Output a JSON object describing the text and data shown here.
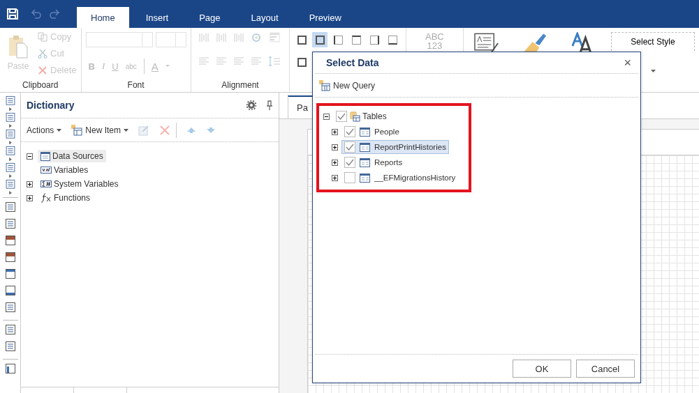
{
  "menu_bar": {
    "tabs": [
      {
        "label": "Home",
        "selected": true
      },
      {
        "label": "Insert",
        "selected": false
      },
      {
        "label": "Page",
        "selected": false
      },
      {
        "label": "Layout",
        "selected": false
      },
      {
        "label": "Preview",
        "selected": false
      }
    ]
  },
  "ribbon": {
    "clipboard": {
      "label": "Clipboard",
      "paste": {
        "label": "Paste",
        "disabled": true
      },
      "items": [
        {
          "label": "Copy",
          "disabled": true
        },
        {
          "label": "Cut",
          "disabled": true
        },
        {
          "label": "Delete",
          "disabled": true
        }
      ]
    },
    "font": {
      "label": "Font",
      "format_buttons": [
        "B",
        "I",
        "U",
        "abc"
      ],
      "color_button": "A"
    },
    "alignment": {
      "label": "Alignment"
    },
    "borders": {
      "row_1": [
        {
          "selected": false
        },
        {
          "selected": true
        },
        {
          "selected": false
        },
        {
          "selected": false
        },
        {
          "selected": false
        },
        {
          "selected": false
        }
      ],
      "row_2": [
        {
          "selected": false
        }
      ]
    },
    "sample_text": [
      "ABC",
      "123"
    ],
    "style_button": "Select Style"
  },
  "dictionary": {
    "title": "Dictionary",
    "actions": "Actions",
    "new_item": "New Item",
    "tree": [
      {
        "label": "Data Sources",
        "kind": "datasource",
        "expanded": true,
        "selected": true
      },
      {
        "label": "Variables",
        "kind": "variable",
        "selected": false
      },
      {
        "label": "System Variables",
        "kind": "sysvar",
        "expanded": false,
        "selected": false
      },
      {
        "label": "Functions",
        "kind": "function",
        "expanded": false,
        "selected": false
      }
    ]
  },
  "designer": {
    "tab": "Pa"
  },
  "dialog": {
    "title": "Select Data",
    "close": "×",
    "new_query": "New Query",
    "tree": {
      "label": "Tables",
      "checked": true,
      "expanded": true,
      "children": [
        {
          "label": "People",
          "checked": true,
          "expanded": false,
          "selected": false
        },
        {
          "label": "ReportPrintHistories",
          "checked": true,
          "expanded": false,
          "selected": true
        },
        {
          "label": "Reports",
          "checked": true,
          "expanded": false,
          "selected": false
        },
        {
          "label": "__EFMigrationsHistory",
          "checked": false,
          "expanded": false,
          "selected": false
        }
      ]
    },
    "buttons": [
      "OK",
      "Cancel"
    ]
  }
}
